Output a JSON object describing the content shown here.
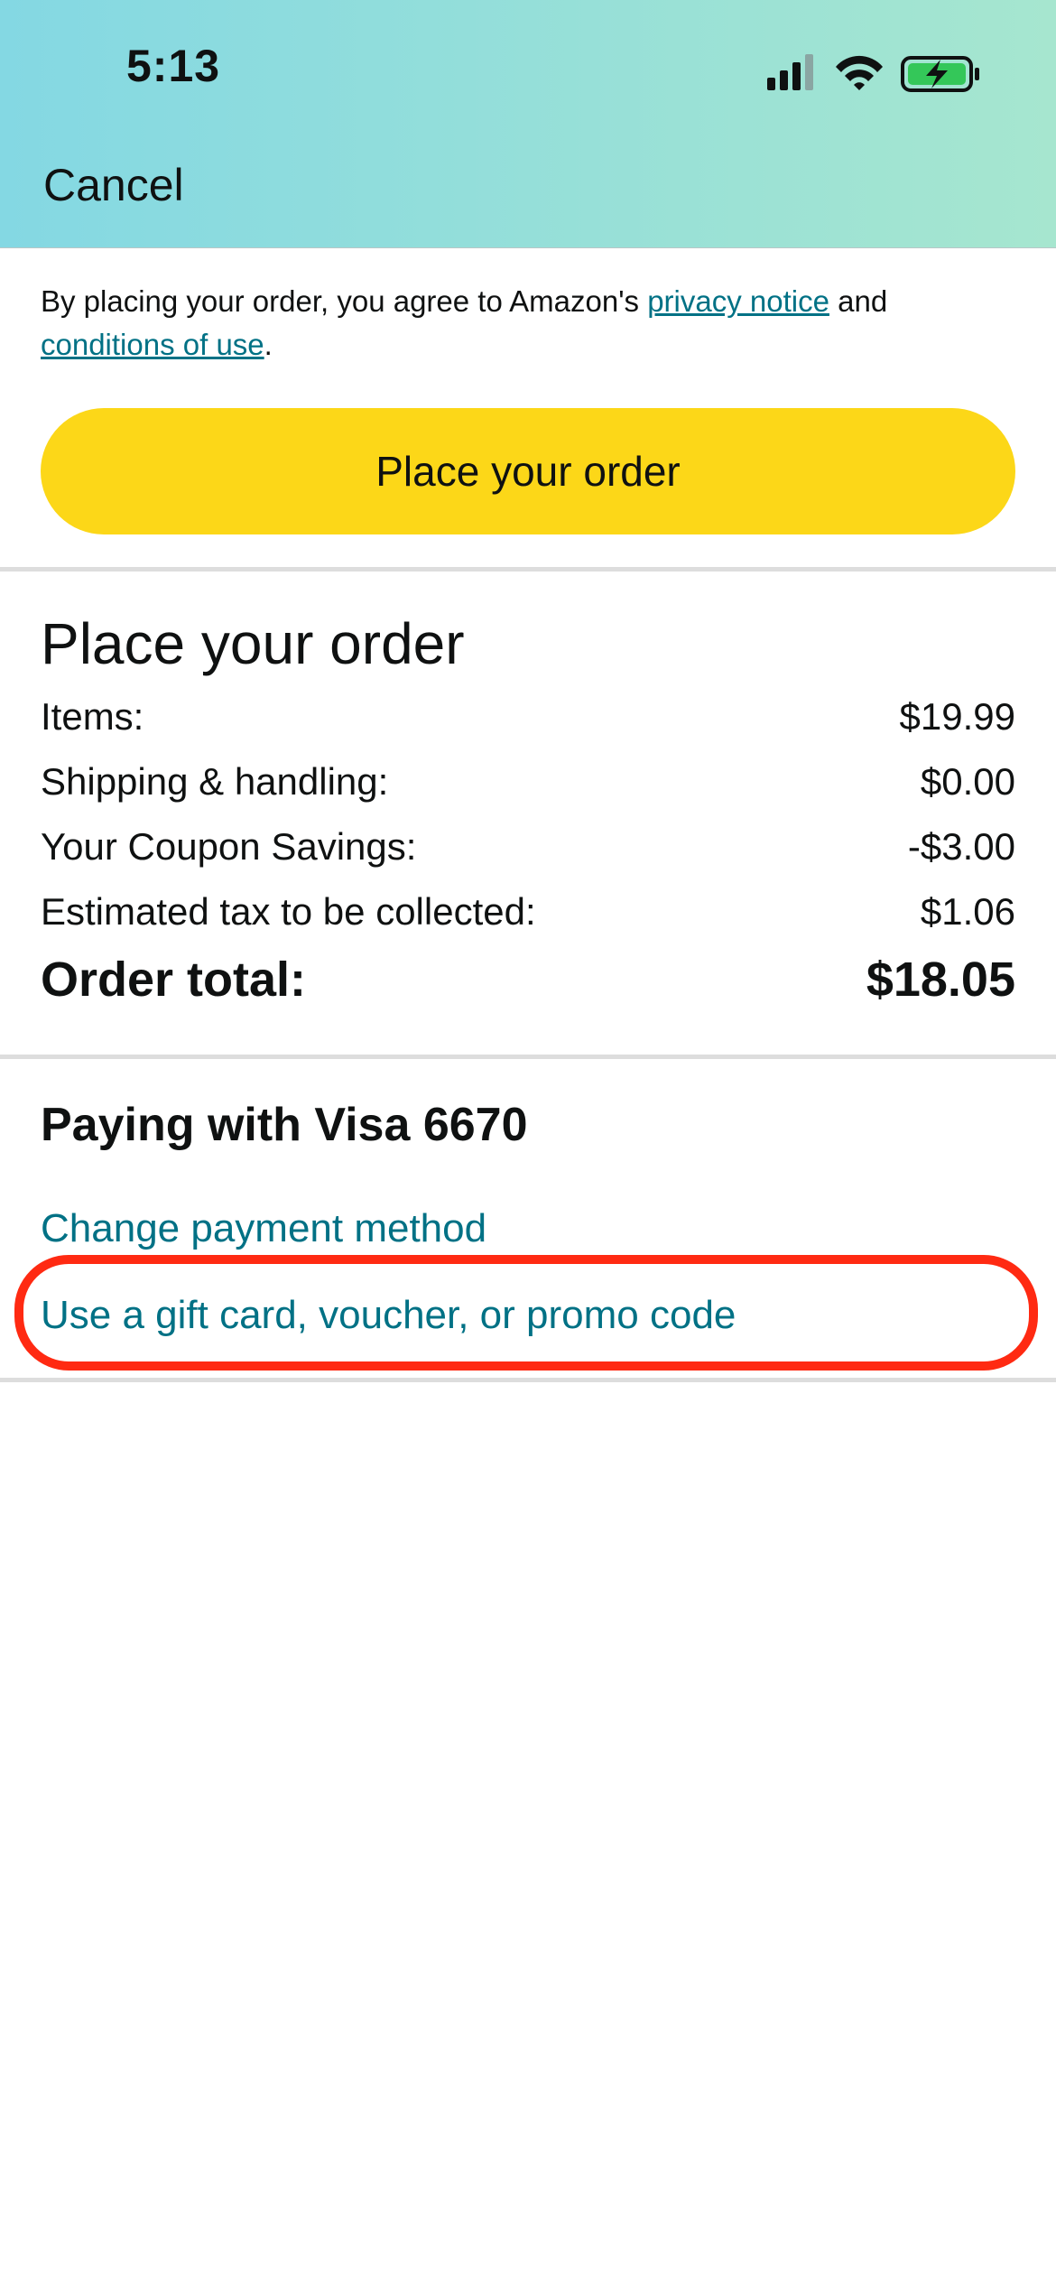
{
  "status_bar": {
    "time": "5:13",
    "icons": [
      "cellular-signal-icon",
      "wifi-icon",
      "battery-charging-icon"
    ],
    "battery_color": "#34c759"
  },
  "nav": {
    "cancel_label": "Cancel"
  },
  "legal": {
    "prefix": "By placing your order, you agree to Amazon's ",
    "privacy_link": "privacy notice",
    "middle": " and ",
    "conditions_link": "conditions of use",
    "suffix": "."
  },
  "place_button": {
    "label": "Place your order",
    "color": "#fcd718"
  },
  "summary": {
    "title": "Place your order",
    "rows": [
      {
        "label": "Items:",
        "value": "$19.99"
      },
      {
        "label": "Shipping & handling:",
        "value": "$0.00"
      },
      {
        "label": "Your Coupon Savings:",
        "value": "-$3.00"
      },
      {
        "label": "Estimated tax to be collected:",
        "value": "$1.06"
      }
    ],
    "total": {
      "label": "Order total:",
      "value": "$18.05"
    }
  },
  "payment": {
    "heading": "Paying with Visa 6670",
    "change_link": "Change payment method",
    "promo_link": "Use a gift card, voucher, or promo code",
    "link_color": "#007185",
    "highlight_color": "#ff2a12"
  }
}
